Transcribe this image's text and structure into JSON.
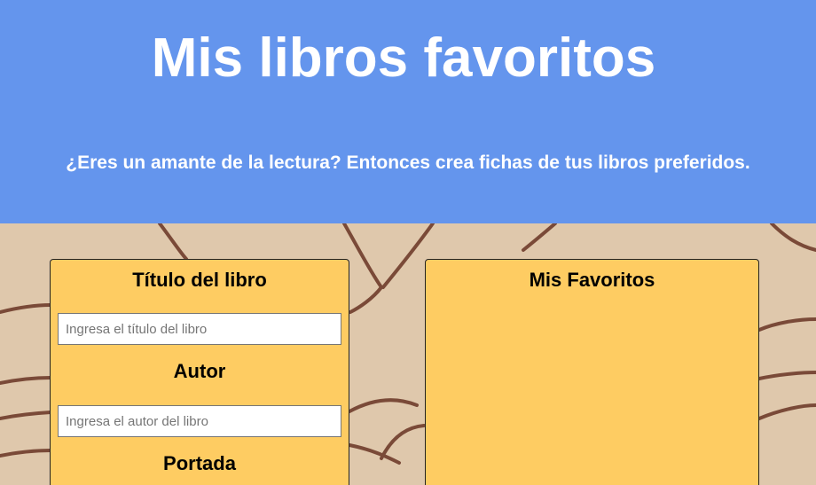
{
  "header": {
    "title": "Mis libros favoritos",
    "subtitle": "¿Eres un amante de la lectura? Entonces crea fichas de tus libros preferidos."
  },
  "form": {
    "title_label": "Título del libro",
    "title_placeholder": "Ingresa el título del libro",
    "title_value": "",
    "author_label": "Autor",
    "author_placeholder": "Ingresa el autor del libro",
    "author_value": "",
    "cover_label": "Portada"
  },
  "favorites": {
    "title": "Mis Favoritos",
    "items": []
  },
  "colors": {
    "header_bg": "#6495ed",
    "header_text": "#ffffff",
    "page_bg": "#dfc8ac",
    "panel_bg": "#fecc62",
    "line_art": "#7a4a38"
  }
}
